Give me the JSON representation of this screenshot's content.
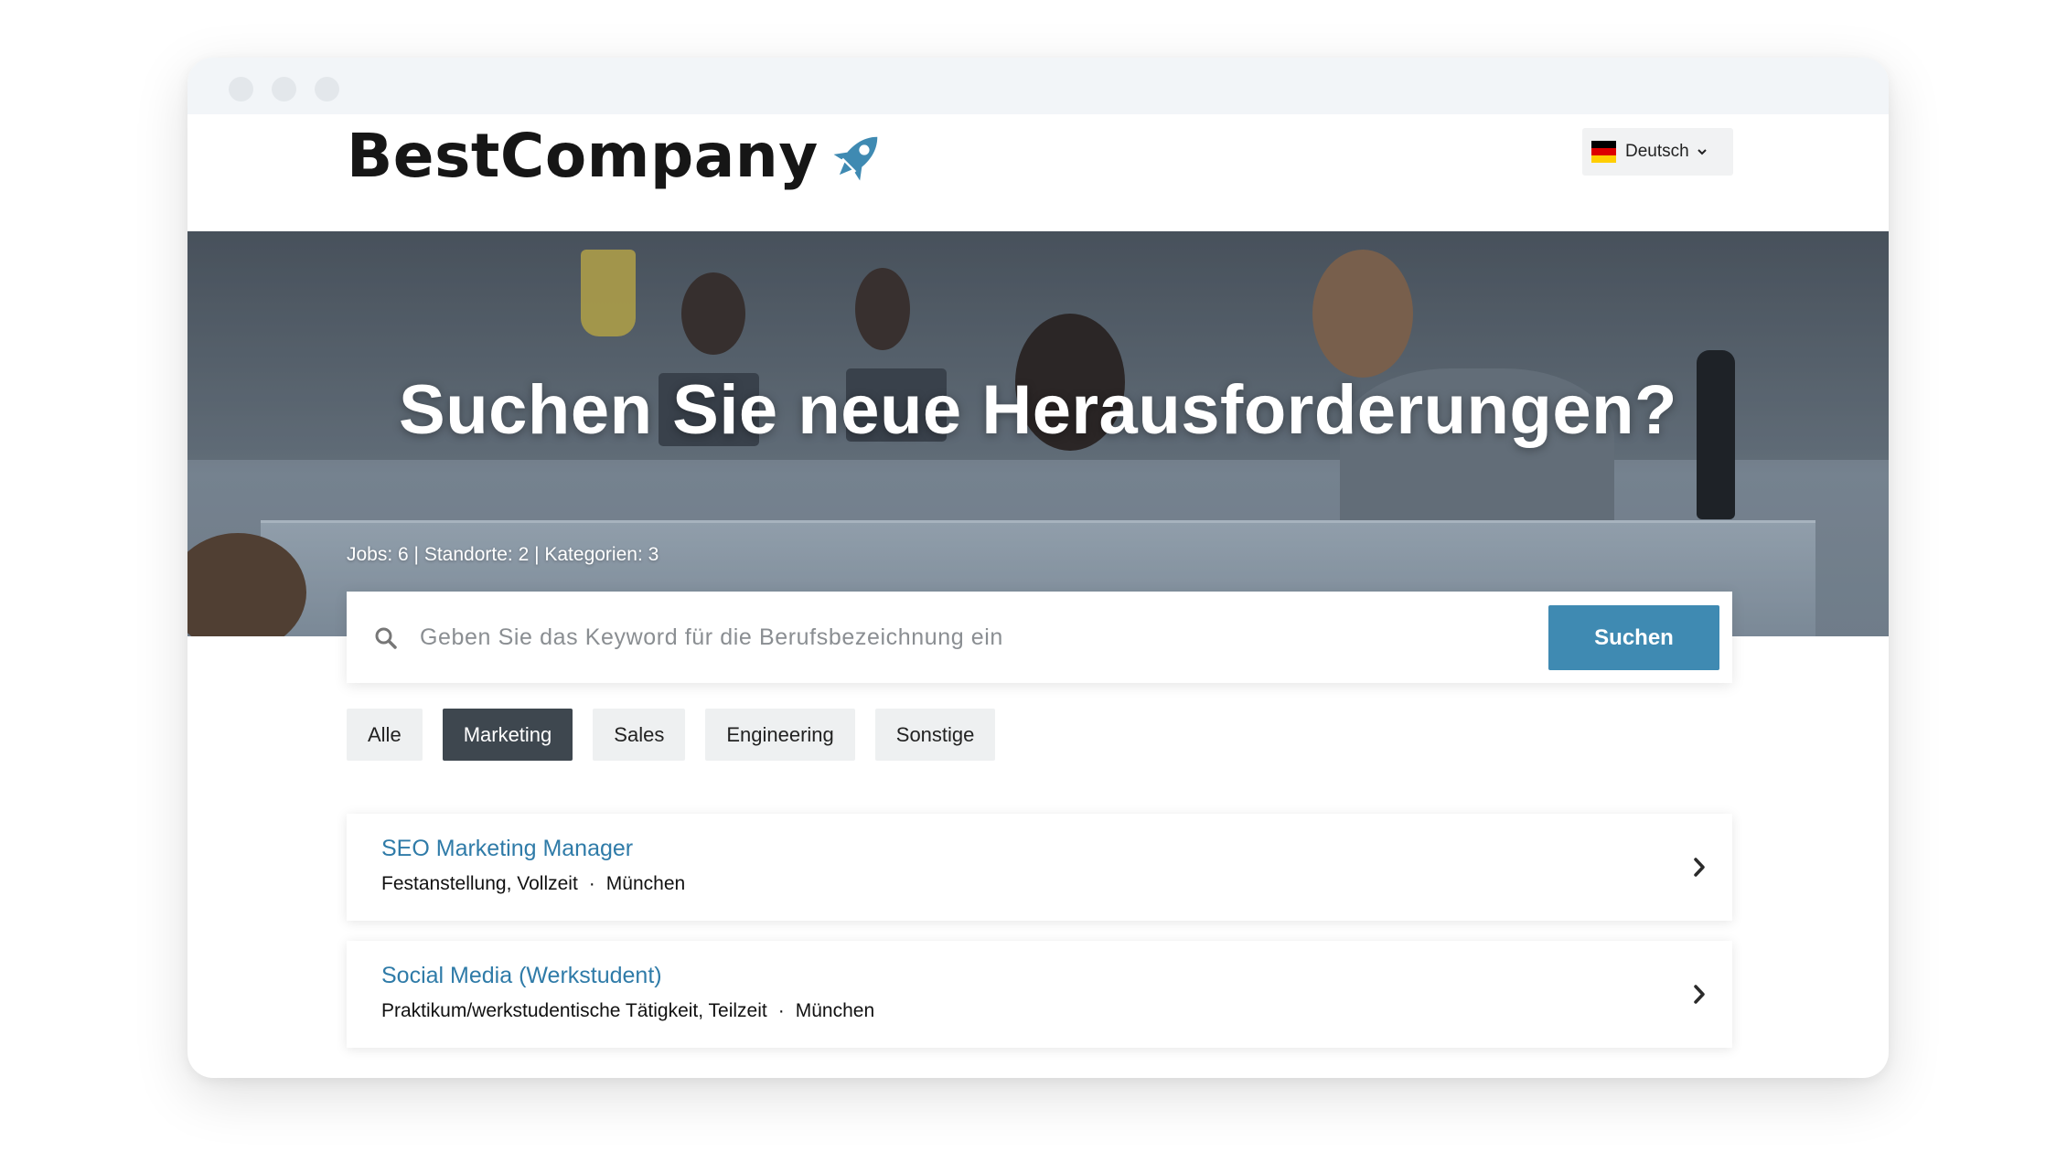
{
  "brand": {
    "name": "BestCompany",
    "accent": "#3f8ab2"
  },
  "language": {
    "label": "Deutsch",
    "flag_icon": "germany-flag-icon"
  },
  "hero": {
    "title": "Suchen Sie neue Herausforderungen?",
    "stats": "Jobs: 6 | Standorte: 2 | Kategorien: 3"
  },
  "search": {
    "placeholder": "Geben Sie das Keyword für die Berufsbezeichnung ein",
    "value": "",
    "button_label": "Suchen"
  },
  "filters": [
    {
      "label": "Alle",
      "active": false
    },
    {
      "label": "Marketing",
      "active": true
    },
    {
      "label": "Sales",
      "active": false
    },
    {
      "label": "Engineering",
      "active": false
    },
    {
      "label": "Sonstige",
      "active": false
    }
  ],
  "jobs": [
    {
      "title": "SEO Marketing Manager",
      "type": "Festanstellung, Vollzeit",
      "location": "München"
    },
    {
      "title": "Social Media (Werkstudent)",
      "type": "Praktikum/werkstudentische Tätigkeit, Teilzeit",
      "location": "München"
    }
  ],
  "separator": "·"
}
